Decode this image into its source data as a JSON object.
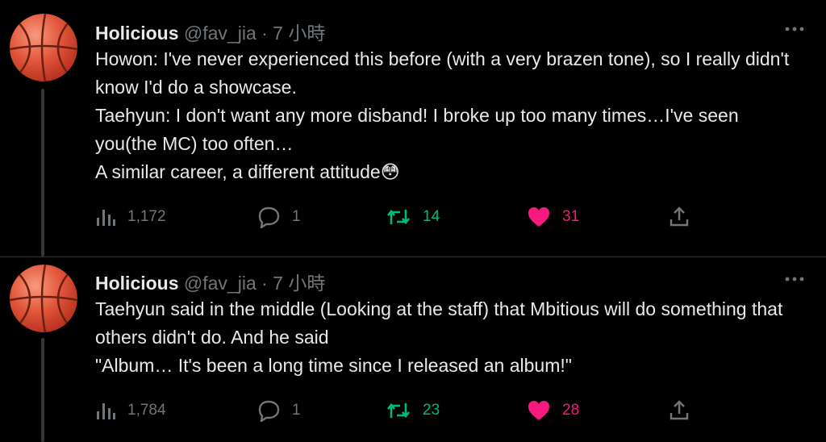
{
  "tweets": [
    {
      "name": "Holicious",
      "meta": "@fav_jia · 7 小時",
      "lines": [
        "Howon: I've never experienced this before (with a very brazen tone), so I really didn't know I'd do a showcase.",
        "Taehyun: I don't want any more disband! I broke up too many times…I've seen you(the MC) too often…",
        "A similar career, a different attitude😳"
      ],
      "views": "1,172",
      "replies": "1",
      "retweets": "14",
      "likes": "31"
    },
    {
      "name": "Holicious",
      "meta": "@fav_jia · 7 小時",
      "lines": [
        "Taehyun said in the middle (Looking at the staff) that Mbitious will do something that others didn't do. And he said",
        "\"Album… It's been a long time since I released an album!\""
      ],
      "views": "1,784",
      "replies": "1",
      "retweets": "23",
      "likes": "28"
    }
  ],
  "colors": {
    "retweet": "#00ba7c",
    "like": "#f91880",
    "muted": "#71767b",
    "avatar": "#e1553a"
  },
  "icons": [
    "basketball-avatar",
    "more-icon",
    "views-icon",
    "reply-icon",
    "retweet-icon",
    "like-icon",
    "share-icon"
  ]
}
